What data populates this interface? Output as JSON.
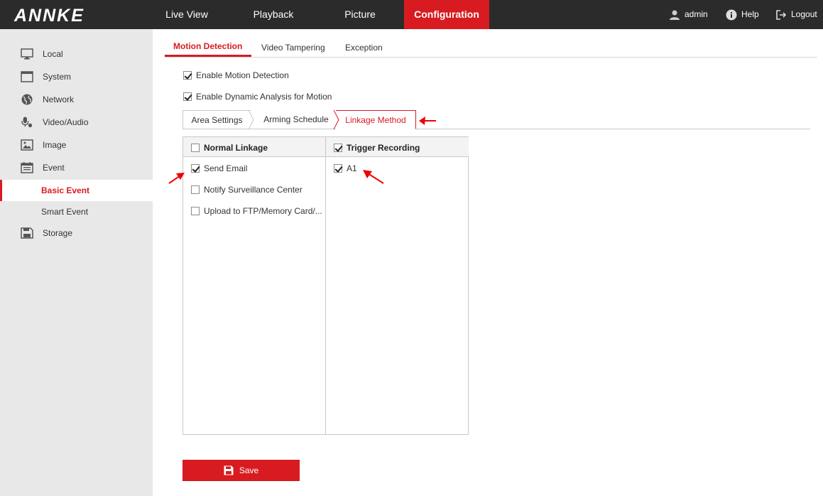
{
  "header": {
    "logo": "ANNKE",
    "nav": [
      "Live View",
      "Playback",
      "Picture",
      "Configuration"
    ],
    "active_nav": "Configuration",
    "user": "admin",
    "help": "Help",
    "logout": "Logout"
  },
  "sidebar": {
    "items": [
      {
        "label": "Local",
        "icon": "monitor-icon"
      },
      {
        "label": "System",
        "icon": "system-window-icon"
      },
      {
        "label": "Network",
        "icon": "globe-icon"
      },
      {
        "label": "Video/Audio",
        "icon": "microphone-icon"
      },
      {
        "label": "Image",
        "icon": "image-icon"
      },
      {
        "label": "Event",
        "icon": "calendar-icon"
      },
      {
        "label": "Storage",
        "icon": "floppy-disk-icon"
      }
    ],
    "sub_items": [
      {
        "label": "Basic Event",
        "active": true
      },
      {
        "label": "Smart Event",
        "active": false
      }
    ]
  },
  "tabs": [
    "Motion Detection",
    "Video Tampering",
    "Exception"
  ],
  "active_tab": "Motion Detection",
  "options": {
    "enable_motion": {
      "label": "Enable Motion Detection",
      "checked": true
    },
    "enable_dynamic": {
      "label": "Enable Dynamic Analysis for Motion",
      "checked": true
    }
  },
  "subtabs": [
    "Area Settings",
    "Arming Schedule",
    "Linkage Method"
  ],
  "active_subtab": "Linkage Method",
  "linkage": {
    "normal": {
      "header": "Normal Linkage",
      "checked": false,
      "items": [
        {
          "label": "Send Email",
          "checked": true
        },
        {
          "label": "Notify Surveillance Center",
          "checked": false
        },
        {
          "label": "Upload to FTP/Memory Card/...",
          "checked": false
        }
      ]
    },
    "trigger": {
      "header": "Trigger Recording",
      "checked": true,
      "items": [
        {
          "label": "A1",
          "checked": true
        }
      ]
    }
  },
  "save_label": "Save",
  "colors": {
    "accent": "#d81b21",
    "topbar": "#2b2b2b",
    "sidebar": "#e8e8e8"
  }
}
